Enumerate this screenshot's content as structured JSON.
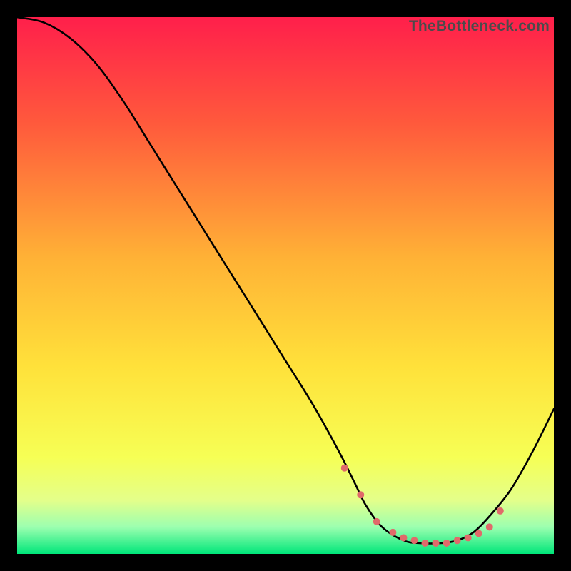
{
  "watermark": "TheBottleneck.com",
  "chart_data": {
    "type": "line",
    "title": "",
    "xlabel": "",
    "ylabel": "",
    "xlim": [
      0,
      100
    ],
    "ylim": [
      0,
      100
    ],
    "grid": false,
    "legend": false,
    "gradient_stops": [
      {
        "offset": 0.0,
        "color": "#ff1f4b"
      },
      {
        "offset": 0.2,
        "color": "#ff5a3c"
      },
      {
        "offset": 0.45,
        "color": "#ffb236"
      },
      {
        "offset": 0.65,
        "color": "#ffe13a"
      },
      {
        "offset": 0.82,
        "color": "#f6ff55"
      },
      {
        "offset": 0.9,
        "color": "#e4ff8a"
      },
      {
        "offset": 0.95,
        "color": "#9cffb0"
      },
      {
        "offset": 1.0,
        "color": "#00e67a"
      }
    ],
    "series": [
      {
        "name": "curve",
        "color": "#000000",
        "x": [
          0,
          5,
          10,
          15,
          20,
          25,
          30,
          35,
          40,
          45,
          50,
          55,
          60,
          63,
          65,
          68,
          72,
          75,
          79,
          82,
          85,
          88,
          92,
          96,
          100
        ],
        "values": [
          100,
          99,
          96,
          91,
          84,
          76,
          68,
          60,
          52,
          44,
          36,
          28,
          19,
          13,
          9,
          5,
          2.5,
          2,
          2,
          2.5,
          4,
          7,
          12,
          19,
          27
        ]
      }
    ],
    "flat_segment_markers": {
      "color": "#e06a6a",
      "radius": 5,
      "x": [
        61,
        64,
        67,
        70,
        72,
        74,
        76,
        78,
        80,
        82,
        84,
        86,
        88,
        90
      ],
      "y": [
        16,
        11,
        6,
        4,
        3,
        2.5,
        2,
        2,
        2,
        2.5,
        3,
        3.8,
        5,
        8
      ]
    }
  }
}
